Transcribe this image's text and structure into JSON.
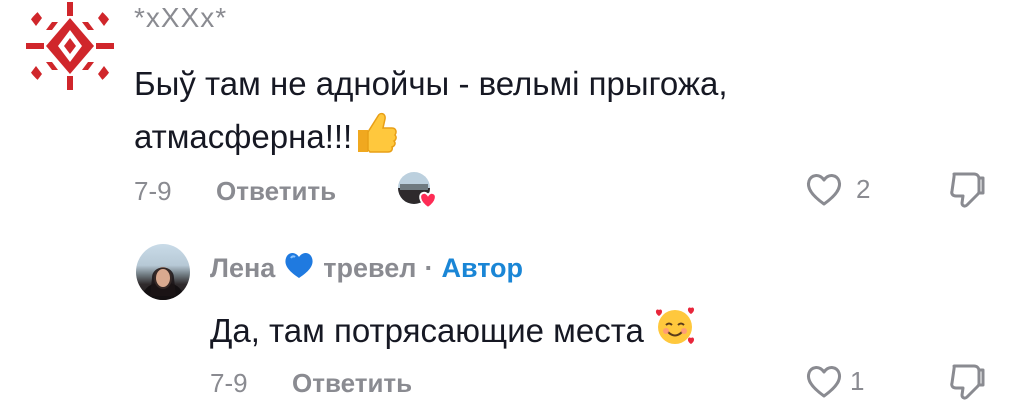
{
  "comments": [
    {
      "author": "*xXXx*",
      "text_line1": "Быў там не аднойчы - вельмі прыгожа,",
      "text_line2": "атмасферна!!!",
      "emoji": "thumbs-up",
      "date": "7-9",
      "reply_label": "Ответить",
      "likes": "2",
      "avatar_icon": "belarusian-ornament-icon",
      "liked_by_author_icon": "heart-badge-icon"
    },
    {
      "author": "Лена",
      "author_emoji": "blue-heart",
      "author_suffix": "тревел",
      "separator": "·",
      "badge": "Автор",
      "text": "Да, там потрясающие места",
      "emoji": "smiling-face-with-hearts",
      "date": "7-9",
      "reply_label": "Ответить",
      "likes": "1"
    }
  ],
  "colors": {
    "text": "#161823",
    "muted": "#8a8b91",
    "author_badge": "#1a86d6",
    "ornament": "#d0262b",
    "like_heart": "#fe2c55"
  }
}
